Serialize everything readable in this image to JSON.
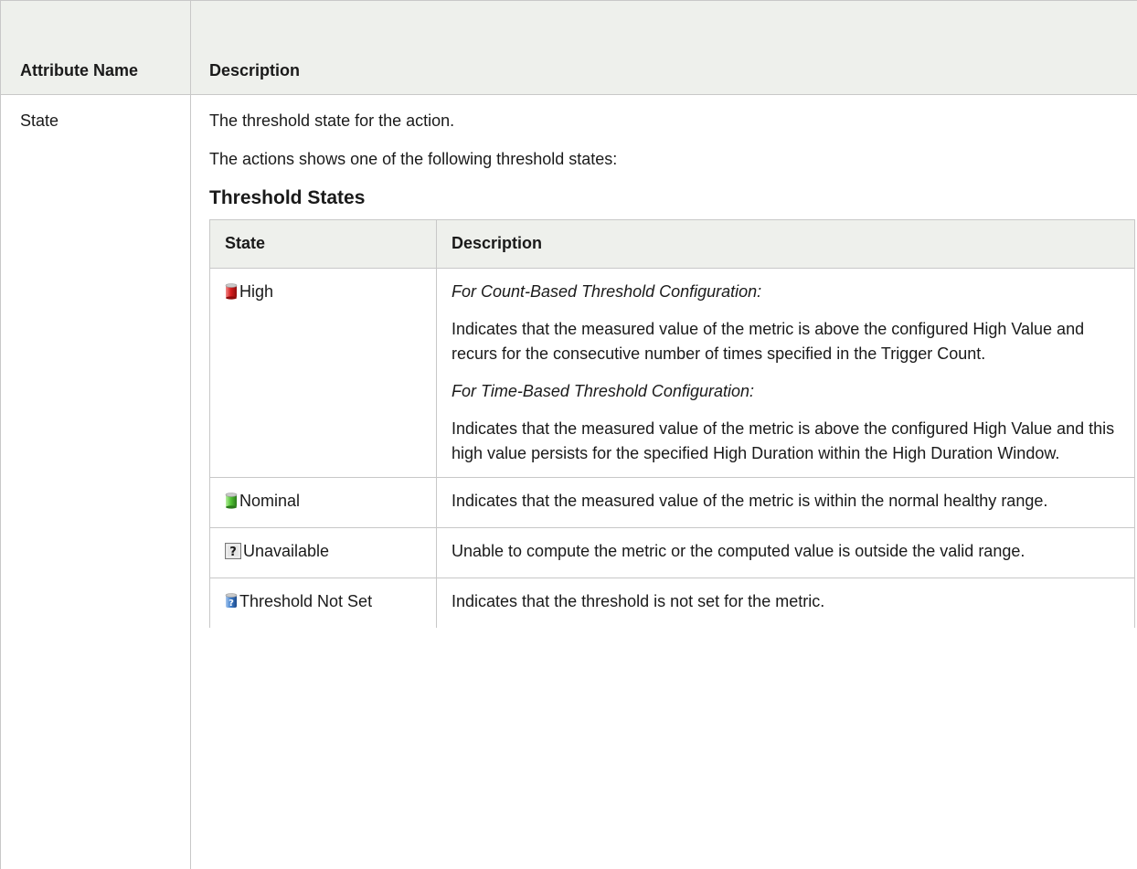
{
  "header": {
    "attribute_name": "Attribute Name",
    "description": "Description"
  },
  "row": {
    "attribute": "State",
    "intro": "The threshold state for the action.",
    "intro2": "The actions shows one of the following threshold states:",
    "subheading": "Threshold States",
    "inner_table": {
      "headers": {
        "state": "State",
        "description": "Description"
      },
      "rows": [
        {
          "icon": "red-cylinder-icon",
          "state": "High",
          "paragraphs": [
            {
              "text": "For Count-Based Threshold Configuration:",
              "italic": true
            },
            {
              "text": "Indicates that the measured value of the metric is above the configured High Value and recurs for the consecutive number of times specified in the Trigger Count.",
              "italic": false
            },
            {
              "text": "For Time-Based Threshold Configuration:",
              "italic": true
            },
            {
              "text": "Indicates that the measured value of the metric is above the configured High Value and this high value persists for the specified High Duration within the High Duration Window.",
              "italic": false
            }
          ]
        },
        {
          "icon": "green-cylinder-icon",
          "state": "Nominal",
          "paragraphs": [
            {
              "text": "Indicates that the measured value of the metric is within the normal healthy range.",
              "italic": false
            }
          ]
        },
        {
          "icon": "question-box-icon",
          "state": "Unavailable",
          "paragraphs": [
            {
              "text": "Unable to compute the metric or the computed value is outside the valid range.",
              "italic": false
            }
          ]
        },
        {
          "icon": "blue-question-cylinder-icon",
          "state": "Threshold Not Set",
          "paragraphs": [
            {
              "text": "Indicates that the threshold is not set for the metric.",
              "italic": false
            }
          ]
        }
      ]
    }
  },
  "colors": {
    "header_bg": "#eef0ec",
    "border": "#c8c8c8",
    "text": "#1a1a1a"
  }
}
